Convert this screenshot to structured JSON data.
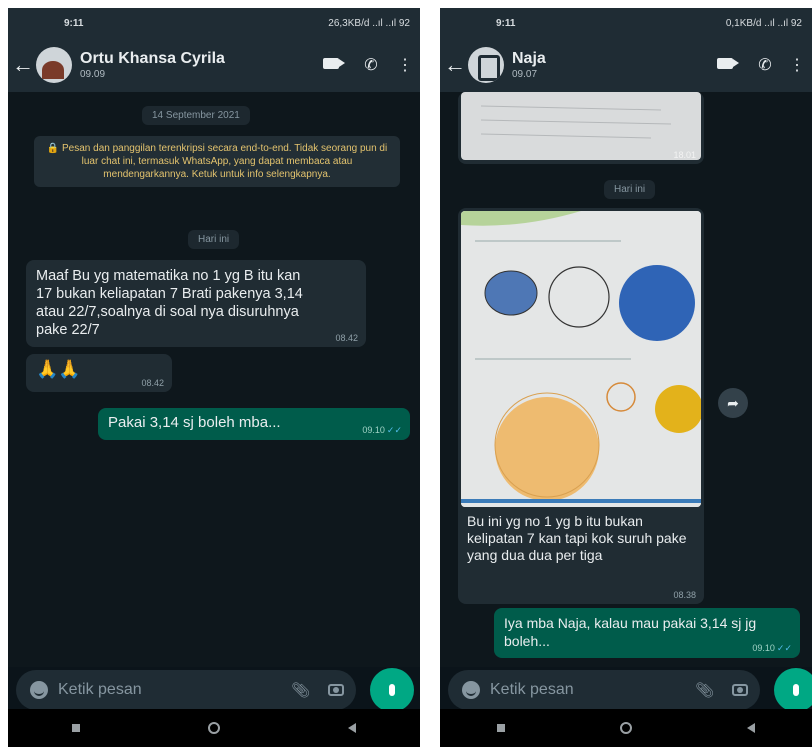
{
  "left": {
    "status_time": "9:11",
    "status_right": "26,3KB/d ..ıl ..ıl 92",
    "contact_name": "Ortu Khansa Cyrila",
    "contact_sub": "09.09",
    "date_chip": "14 September 2021",
    "encryption_notice": "🔒 Pesan dan panggilan terenkripsi secara end-to-end. Tidak seorang pun di luar chat ini, termasuk WhatsApp, yang dapat membaca atau mendengarkannya. Ketuk untuk info selengkapnya.",
    "today_chip": "Hari ini",
    "messages": [
      {
        "dir": "in",
        "text": "Maaf Bu yg matematika no 1 yg B itu kan 17 bukan keliapatan 7 Brati pakenya 3,14 atau 22/7,soalnya di soal nya disuruhnya pake 22/7",
        "time": "08.42"
      },
      {
        "dir": "in",
        "text": "🙏🙏",
        "time": "08.42"
      },
      {
        "dir": "out",
        "text": "Pakai 3,14 sj boleh mba...",
        "time": "09.10"
      }
    ],
    "input_placeholder": "Ketik pesan"
  },
  "right": {
    "status_time": "9:11",
    "status_right": "0,1KB/d ..ıl ..ıl 92",
    "contact_name": "Naja",
    "contact_sub": "09.07",
    "image1_time": "18.01",
    "today_chip": "Hari ini",
    "image_caption": "Bu ini yg no 1 yg b itu bukan kelipatan 7 kan tapi kok suruh pake yang dua dua per tiga",
    "image_caption_time": "08.38",
    "reply_text": "Iya mba Naja, kalau mau pakai 3,14 sj jg boleh...",
    "reply_time": "09.10",
    "input_placeholder": "Ketik pesan"
  },
  "colors": {
    "chat_bg": "#0b141a",
    "header_bg": "#1f2c34",
    "incoming_bubble": "#202c33",
    "outgoing_bubble": "#005c4b",
    "accent": "#00a884",
    "notice_text": "#e3c36e"
  },
  "icons": [
    "back-arrow-icon",
    "video-call-icon",
    "phone-icon",
    "more-icon",
    "emoji-icon",
    "attach-icon",
    "camera-icon",
    "mic-icon",
    "share-icon",
    "read-ticks-icon"
  ]
}
